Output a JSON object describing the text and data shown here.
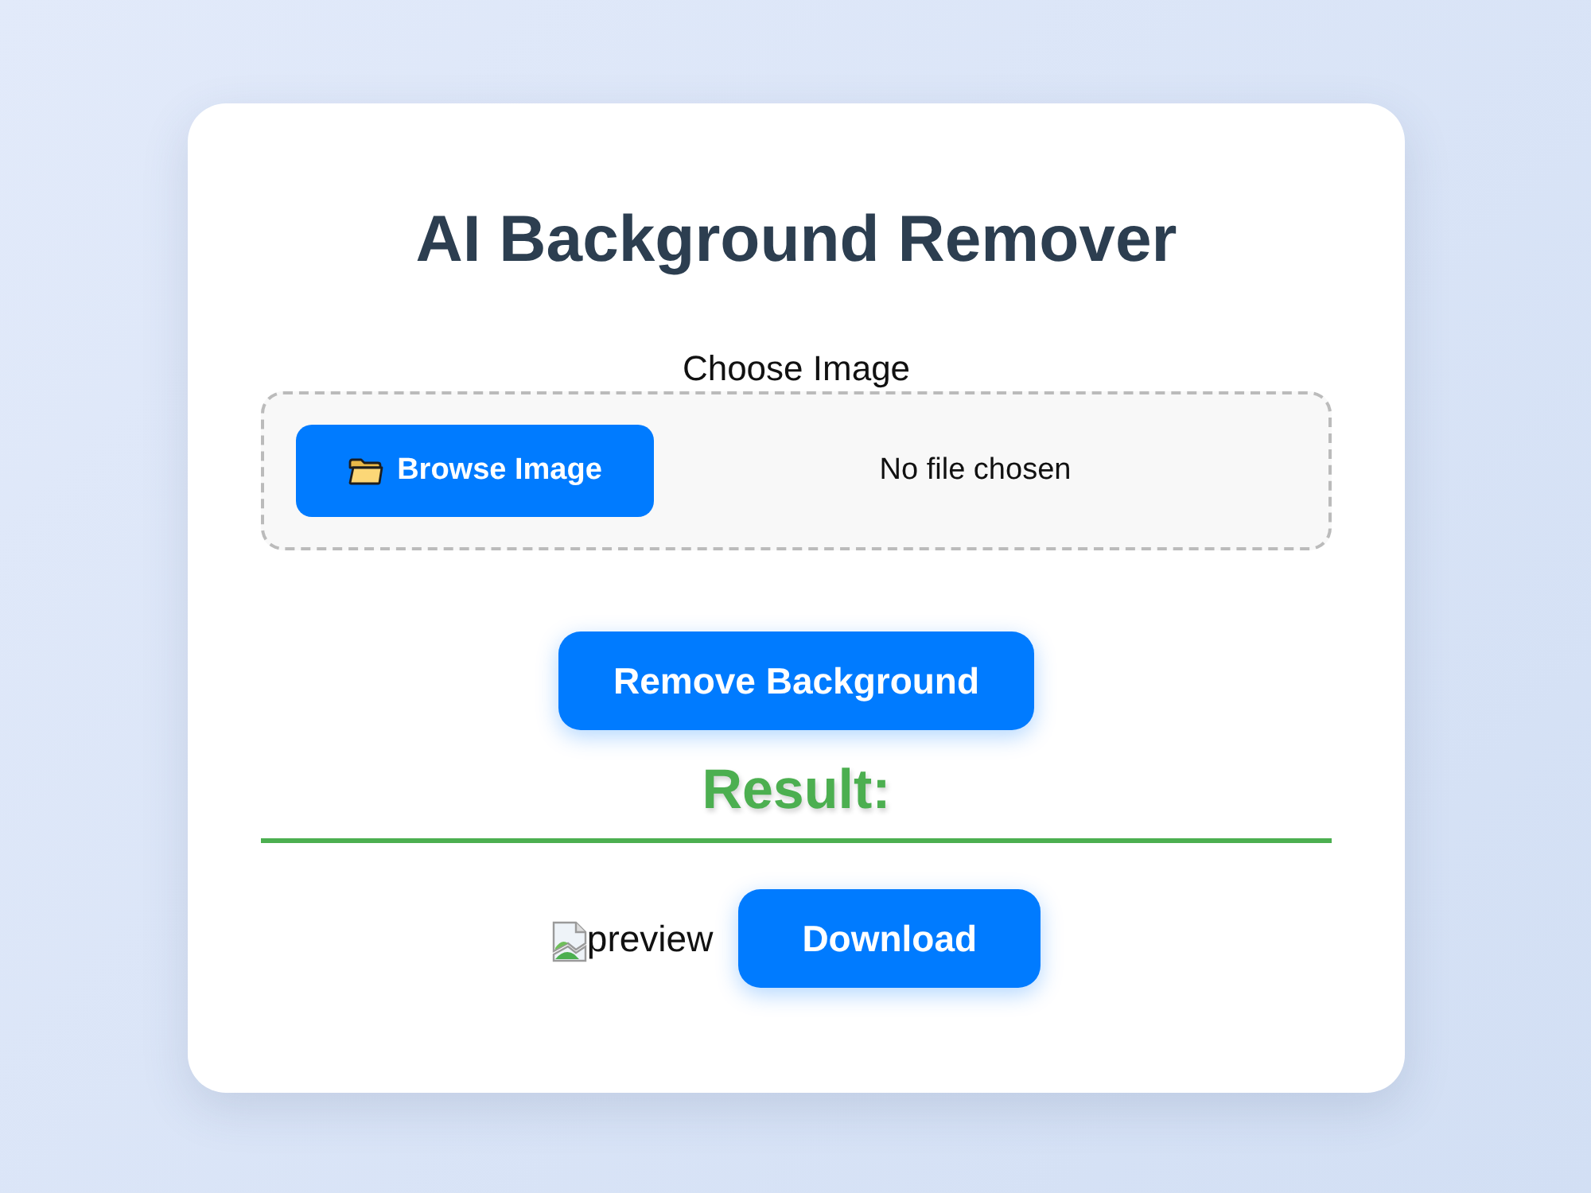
{
  "title": "AI Background Remover",
  "upload": {
    "label": "Choose Image",
    "browse_button": "Browse Image",
    "file_status": "No file chosen"
  },
  "remove_button": "Remove Background",
  "result": {
    "heading": "Result:",
    "preview_alt": "preview",
    "download_button": "Download"
  }
}
